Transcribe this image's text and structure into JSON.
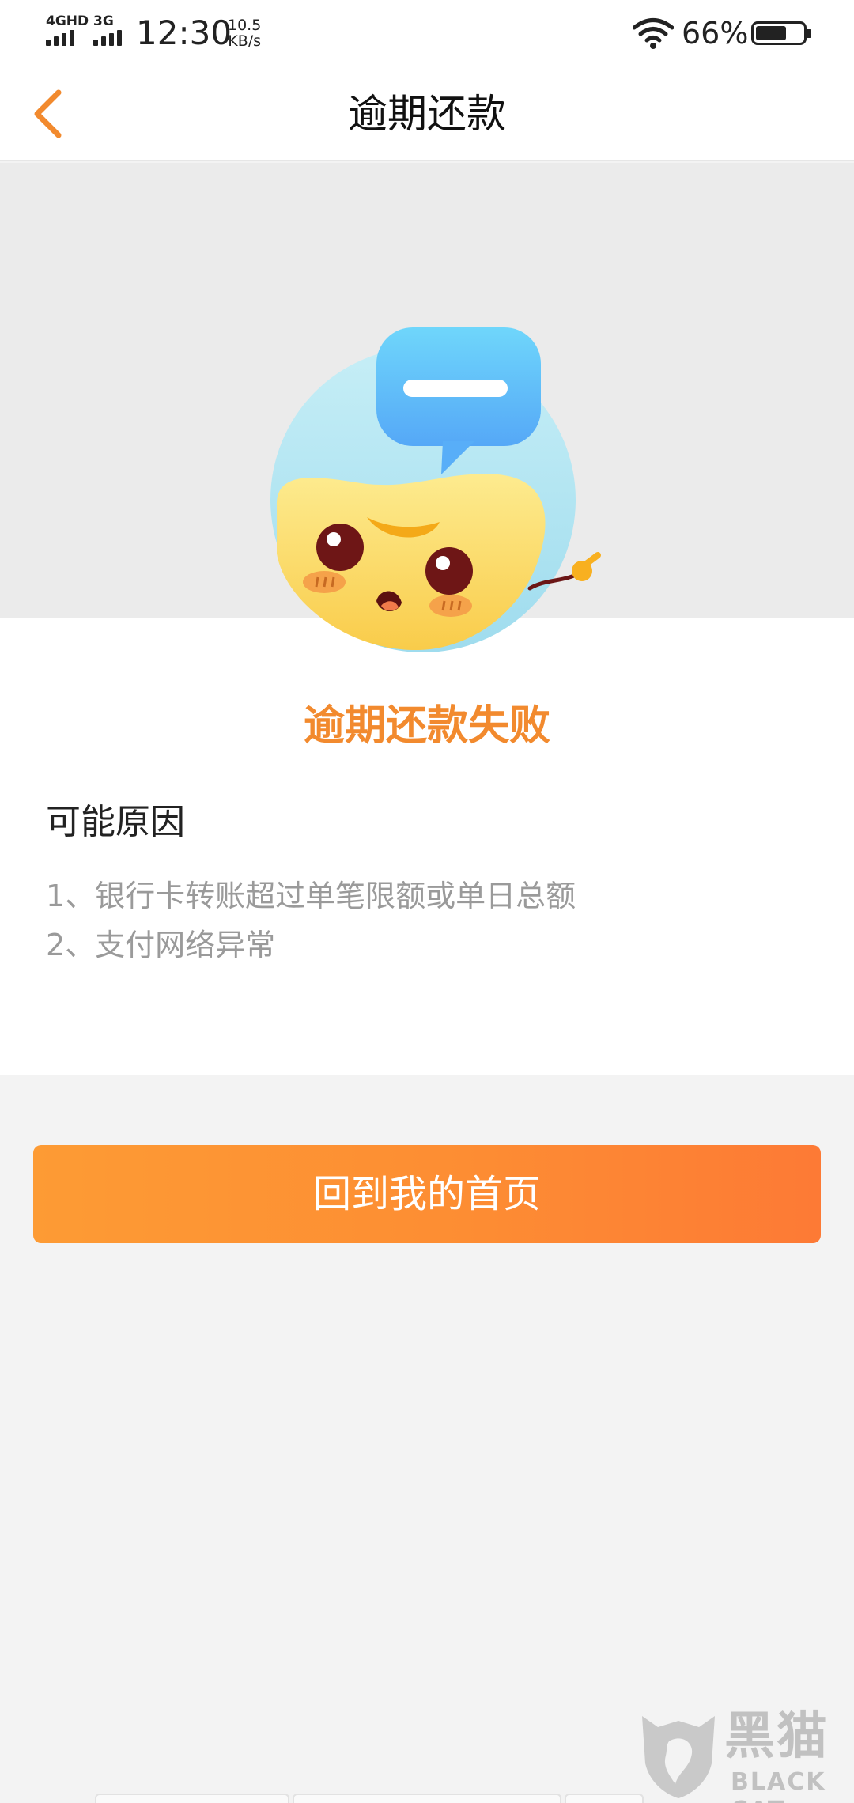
{
  "status_bar": {
    "network_1": "4GHD",
    "network_2": "3G",
    "time": "12:30",
    "speed_value": "10.5",
    "speed_unit": "KB/s",
    "battery_percent": "66%",
    "battery_level": 0.66,
    "icons": [
      "signal-icon",
      "wifi-icon",
      "battery-icon"
    ]
  },
  "nav": {
    "title": "逾期还款",
    "back_icon": "chevron-left-icon",
    "accent_color": "#f28a2e"
  },
  "result": {
    "mascot_icon": "mascot-with-minus-bubble-icon",
    "title": "逾期还款失败",
    "reasons_heading": "可能原因",
    "reasons": [
      "1、银行卡转账超过单笔限额或单日总额",
      "2、支付网络异常"
    ]
  },
  "actions": {
    "home_button_label": "回到我的首页",
    "button_color": "#fd8d33"
  },
  "watermark": {
    "text_cn": "黑猫",
    "text_en": "BLACK CAT"
  }
}
